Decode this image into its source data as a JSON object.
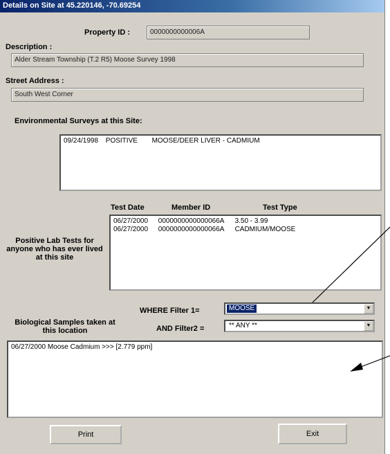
{
  "window": {
    "title": "Details on Site at 45.220146, -70.69254"
  },
  "property": {
    "label": "Property ID :",
    "value": "0000000000006A"
  },
  "description": {
    "label": "Description :",
    "value": "Alder Stream Township (T.2 R5) Moose Survey 1998"
  },
  "street": {
    "label": "Street Address :",
    "value": "South West Corner"
  },
  "env_surveys": {
    "label": "Environmental Surveys at this Site:",
    "items": [
      {
        "date": "09/24/1998",
        "result": "POSITIVE",
        "detail": "MOOSE/DEER LIVER - CADMIUM"
      }
    ]
  },
  "lab_tests": {
    "side_label": "Positive Lab Tests for anyone who has ever lived at this site",
    "columns": {
      "date": "Test Date",
      "member": "Member ID",
      "type": "Test Type"
    },
    "rows": [
      {
        "date": "06/27/2000",
        "member": "0000000000000066A",
        "type": "3.50 - 3.99"
      },
      {
        "date": "06/27/2000",
        "member": "0000000000000066A",
        "type": "CADMIUM/MOOSE"
      }
    ]
  },
  "filters": {
    "filter1_label": "WHERE Filter 1=",
    "filter1_value": "MOOSE",
    "filter2_label": "AND Filter2 =",
    "filter2_value": "** ANY **"
  },
  "bio_samples": {
    "label": "Biological Samples taken at this location",
    "items": [
      "06/27/2000 Moose Cadmium  >>>  [2.779  ppm]"
    ]
  },
  "buttons": {
    "print": "Print",
    "exit": "Exit"
  }
}
